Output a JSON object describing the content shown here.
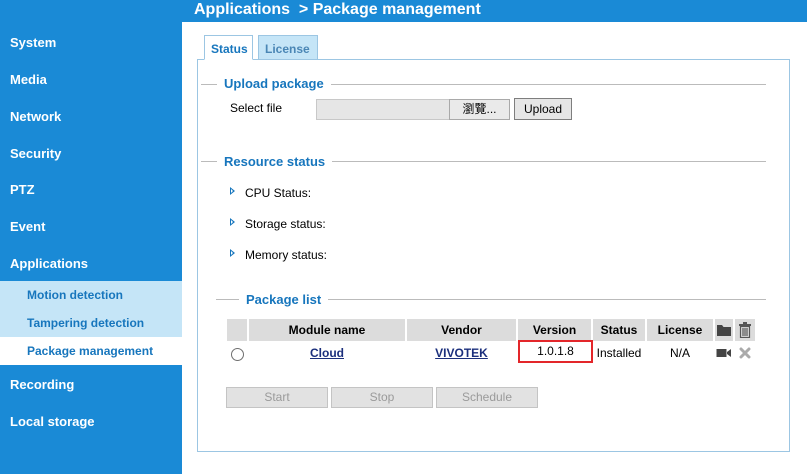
{
  "sidebar": {
    "items": [
      {
        "label": "System"
      },
      {
        "label": "Media"
      },
      {
        "label": "Network"
      },
      {
        "label": "Security"
      },
      {
        "label": "PTZ"
      },
      {
        "label": "Event"
      },
      {
        "label": "Applications"
      },
      {
        "label": "Recording"
      },
      {
        "label": "Local storage"
      }
    ],
    "sub_items": [
      {
        "label": "Motion detection"
      },
      {
        "label": "Tampering detection"
      },
      {
        "label": "Package management",
        "active": true
      }
    ]
  },
  "header": {
    "title": "Applications  > Package management"
  },
  "tabs": [
    {
      "label": "Status",
      "active": true
    },
    {
      "label": "License",
      "active": false
    }
  ],
  "upload": {
    "section_title": "Upload package",
    "select_file_label": "Select file",
    "file_value": "",
    "browse_label": "瀏覽...",
    "upload_label": "Upload"
  },
  "resource": {
    "section_title": "Resource status",
    "cpu_label": "CPU Status:",
    "storage_label": "Storage status:",
    "memory_label": "Memory status:"
  },
  "packages": {
    "section_title": "Package list",
    "columns": {
      "module": "Module name",
      "vendor": "Vendor",
      "version": "Version",
      "status": "Status",
      "license": "License"
    },
    "rows": [
      {
        "module": "Cloud",
        "vendor": "VIVOTEK",
        "version": "1.0.1.8",
        "status": "Installed",
        "license": "N/A"
      }
    ]
  },
  "actions": {
    "start": "Start",
    "stop": "Stop",
    "schedule": "Schedule"
  },
  "colors": {
    "brand_blue": "#1a8ad6",
    "submenu_bg": "#c5e5f7",
    "highlight_red": "#e3262a"
  }
}
